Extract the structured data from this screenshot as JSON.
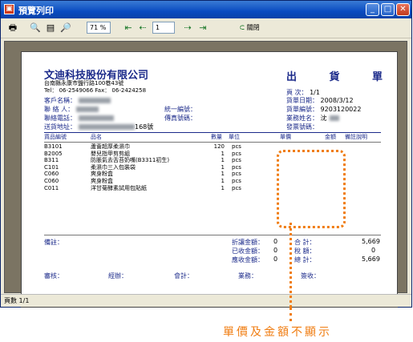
{
  "window": {
    "title": "預覽列印",
    "status": "頁數 1/1"
  },
  "toolbar": {
    "zoom": "71 %",
    "page": "1",
    "close_label": "關閉"
  },
  "doc": {
    "company": "文迪科技股份有限公司",
    "address": "台南縣永康市鹽行路100巷43號",
    "tel": "Tel：  06-2549066     Fax：  06-2424258",
    "title": "出  貨  單",
    "left_labels": [
      "客戶名稱：",
      "聯 絡 人：",
      "聯絡電話：",
      "送貨地址："
    ],
    "addr_suffix": "168號",
    "mid_labels": [
      "統一編號：",
      "傳真號碼："
    ],
    "right_labels": [
      "頁   次：",
      "貨單日期：",
      "貨單編號：",
      "業務姓名：",
      "發票號碼："
    ],
    "right_values": [
      "1/1",
      "2008/3/12",
      "9203120022",
      "沈"
    ],
    "headers": [
      "貨品編號",
      "品名",
      "數量",
      "單位",
      "單價",
      "金額",
      "備註說明"
    ],
    "items": [
      {
        "code": "B3101",
        "name": "蘆薈超厚柔濕巾",
        "qty": "120",
        "unit": "pcs"
      },
      {
        "code": "B2005",
        "name": "嬰兒指甲剪剪組",
        "qty": "1",
        "unit": "pcs"
      },
      {
        "code": "B311",
        "name": "防脹氣去舌苔奶嘴(B3311初生)",
        "qty": "1",
        "unit": "pcs"
      },
      {
        "code": "C101",
        "name": "柔濕巾三入包裝袋",
        "qty": "1",
        "unit": "pcs"
      },
      {
        "code": "C060",
        "name": "爽身粉盒",
        "qty": "1",
        "unit": "pcs"
      },
      {
        "code": "C060",
        "name": "爽身粉盒",
        "qty": "1",
        "unit": "pcs"
      },
      {
        "code": "C011",
        "name": "洋甘菊酵素試用包貼紙",
        "qty": "1",
        "unit": "pcs"
      }
    ],
    "remark_label": "備註：",
    "sum_labels": [
      "折讓金額：",
      "已收金額：",
      "應收金額："
    ],
    "sum_values": [
      "0",
      "0",
      "0"
    ],
    "total_labels": [
      "合     計：",
      "稅     額：",
      "總     計："
    ],
    "total_values": [
      "5,669",
      "0",
      "5,669"
    ],
    "sign_labels": [
      "審核：",
      "經辦：",
      "會計：",
      "業務：",
      "簽收："
    ]
  },
  "annotation": "單價及金額不顯示",
  "colors": {
    "title_bar": "#0a4bc1",
    "doc_blue": "#1b2a8a",
    "highlight": "#f07d12"
  }
}
